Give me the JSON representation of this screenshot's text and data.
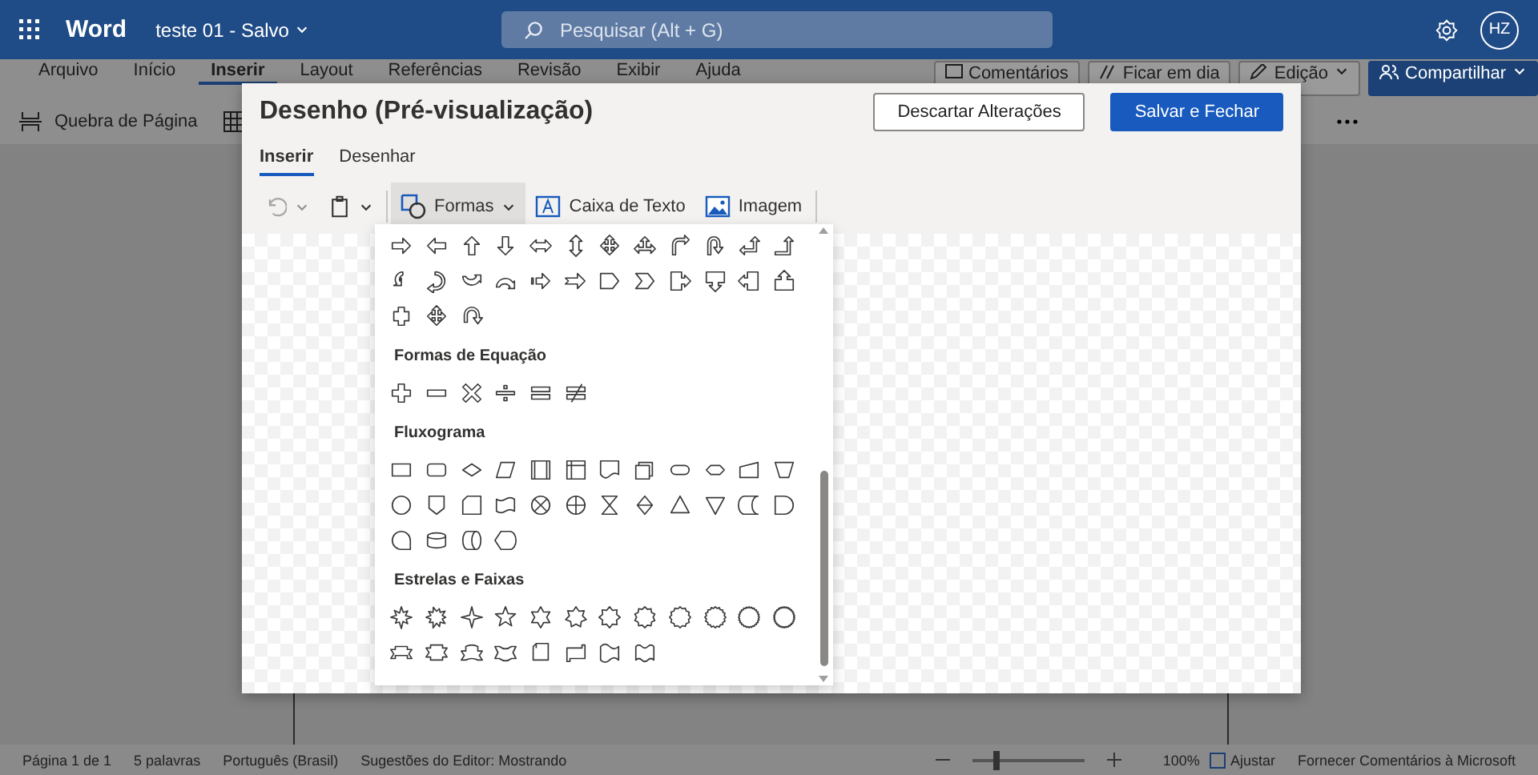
{
  "app_bar": {
    "app_name": "Word",
    "document": "teste 01",
    "separator": "-",
    "save_status": "Salvo",
    "search": {
      "placeholder": "Pesquisar (Alt + G)"
    },
    "avatar": "HZ"
  },
  "ribbon": {
    "tabs": [
      {
        "label": "Arquivo",
        "selected": false
      },
      {
        "label": "Início",
        "selected": false
      },
      {
        "label": "Inserir",
        "selected": true
      },
      {
        "label": "Layout",
        "selected": false
      },
      {
        "label": "Referências",
        "selected": false
      },
      {
        "label": "Revisão",
        "selected": false
      },
      {
        "label": "Exibir",
        "selected": false
      },
      {
        "label": "Ajuda",
        "selected": false
      }
    ],
    "actions": [
      {
        "label": "Comentários",
        "kind": "comments"
      },
      {
        "label": "Ficar em dia",
        "kind": "catchup"
      },
      {
        "label": "Edição",
        "kind": "editing"
      },
      {
        "label": "Compartilhar",
        "kind": "share"
      }
    ],
    "command": "Quebra de Página"
  },
  "dialog": {
    "title": "Desenho (Pré-visualização)",
    "buttons": [
      {
        "label": "Descartar Alterações",
        "primary": false
      },
      {
        "label": "Salvar e Fechar",
        "primary": true
      }
    ],
    "tabs": [
      {
        "label": "Inserir",
        "selected": true
      },
      {
        "label": "Desenhar",
        "selected": false
      }
    ],
    "toolbar": [
      {
        "kind": "undo",
        "disabled": true,
        "active": false
      },
      {
        "kind": "paste",
        "disabled": false,
        "active": false
      },
      {
        "kind": "shapes",
        "label": "Formas",
        "disabled": false,
        "active": true
      },
      {
        "kind": "textbox",
        "label": "Caixa de Texto",
        "disabled": false,
        "active": false
      },
      {
        "kind": "image",
        "label": "Imagem",
        "disabled": false,
        "active": false
      }
    ],
    "shapes_menu": {
      "sections": [
        {
          "kind": "untitled"
        },
        {
          "kind": "titled",
          "title": "Formas de Equação"
        },
        {
          "kind": "titled",
          "title": "Fluxograma"
        },
        {
          "kind": "titled",
          "title": "Estrelas e Faixas"
        }
      ]
    }
  },
  "status_bar": {
    "items": [
      "Página 1 de 1",
      "5 palavras",
      "Português (Brasil)",
      "Sugestões do Editor: Mostrando"
    ],
    "zoom": {
      "level": 0.22,
      "reading": "100%"
    },
    "fit": "Ajustar",
    "feedback": "Fornecer Comentários à Microsoft"
  }
}
